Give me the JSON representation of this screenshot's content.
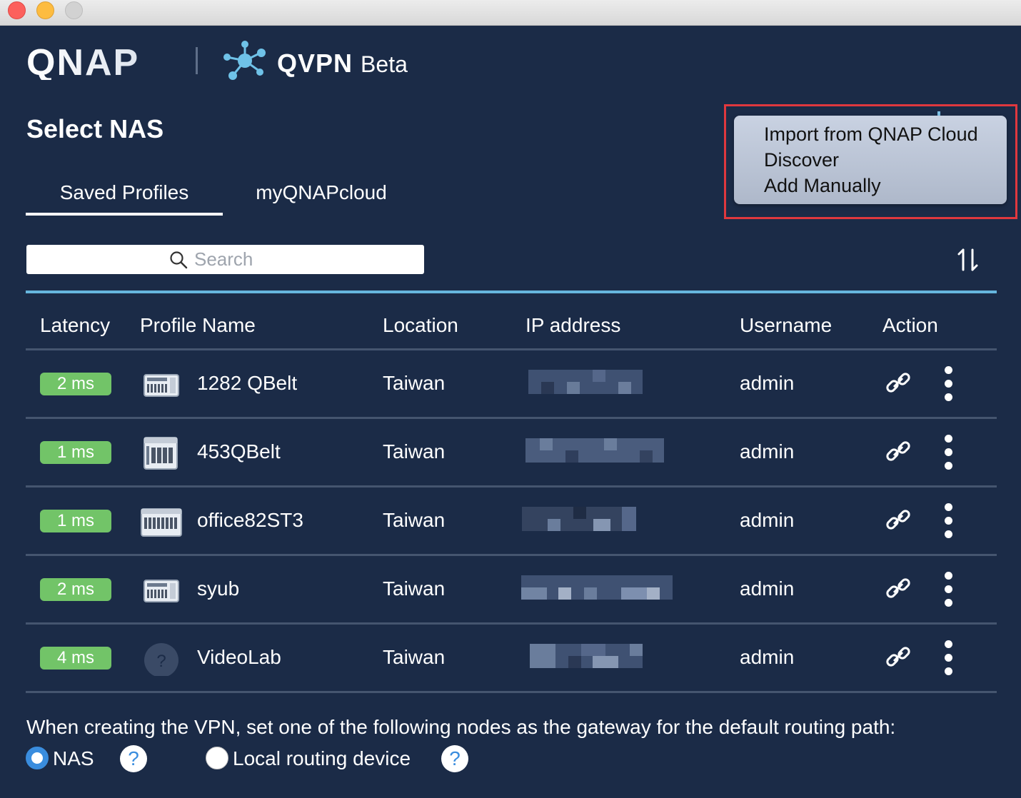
{
  "header": {
    "brand": "QNAP",
    "app_name": "QVPN",
    "app_suffix": "Beta"
  },
  "page_title": "Select NAS",
  "tabs": [
    {
      "label": "Saved Profiles",
      "active": true
    },
    {
      "label": "myQNAPcloud",
      "active": false
    }
  ],
  "add_menu": {
    "items": [
      "Import from QNAP Cloud",
      "Discover",
      "Add Manually"
    ]
  },
  "search": {
    "placeholder": "Search",
    "value": ""
  },
  "table": {
    "columns": [
      "Latency",
      "Profile Name",
      "Location",
      "IP address",
      "Username",
      "Action"
    ],
    "rows": [
      {
        "latency": "2 ms",
        "name": "1282 QBelt",
        "location": "Taiwan",
        "username": "admin",
        "device_icon": "nas-rack-small-icon"
      },
      {
        "latency": "1 ms",
        "name": "453QBelt",
        "location": "Taiwan",
        "username": "admin",
        "device_icon": "nas-tower-icon"
      },
      {
        "latency": "1 ms",
        "name": "office82ST3",
        "location": "Taiwan",
        "username": "admin",
        "device_icon": "nas-rack-wide-icon"
      },
      {
        "latency": "2 ms",
        "name": "syub",
        "location": "Taiwan",
        "username": "admin",
        "device_icon": "nas-rack-small-icon"
      },
      {
        "latency": "4 ms",
        "name": "VideoLab",
        "location": "Taiwan",
        "username": "admin",
        "device_icon": "unknown-device-icon"
      }
    ]
  },
  "gateway": {
    "instruction": "When creating the VPN, set one of the following nodes as the gateway for the default routing path:",
    "options": [
      {
        "label": "NAS",
        "selected": true
      },
      {
        "label": "Local routing device",
        "selected": false
      }
    ],
    "help_glyph": "?"
  },
  "colors": {
    "background": "#1b2b47",
    "latency_badge": "#72c468",
    "accent_line": "#66b6de",
    "menu_highlight": "#e0383e",
    "radio_selected": "#3a8dde"
  }
}
